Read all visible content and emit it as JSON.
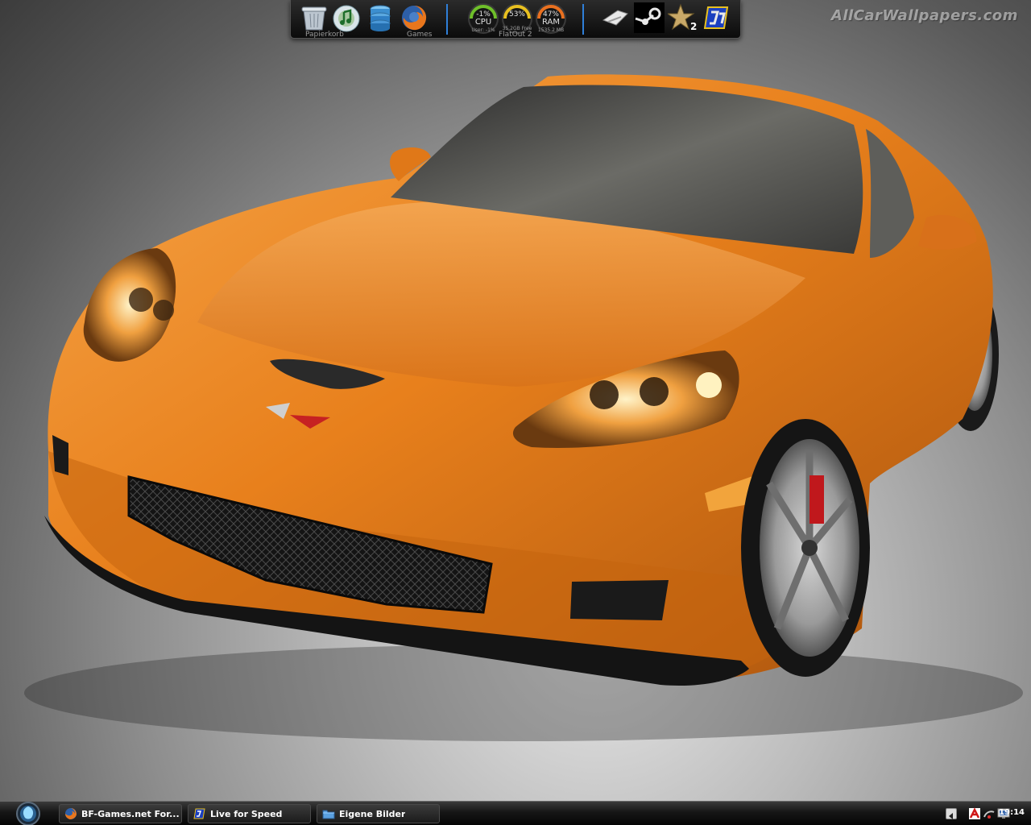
{
  "desktop": {
    "watermark": "AllCarWallpapers.com"
  },
  "dock": {
    "items": [
      {
        "name": "Papierkorb",
        "icon": "recycle-bin-icon"
      },
      {
        "name": "",
        "icon": "music-player-icon"
      },
      {
        "name": "",
        "icon": "database-icon"
      },
      {
        "name": "Games",
        "icon": "firefox-icon"
      }
    ],
    "gauges": [
      {
        "name": "CPU",
        "pct": "-1%",
        "sub": "User: -1%"
      },
      {
        "name": "C:\\",
        "pct": "53%",
        "sub": "35.2GB Free",
        "label": "FlatOut 2"
      },
      {
        "name": "RAM",
        "pct": "47%",
        "sub": "1535.2 MB"
      }
    ],
    "launchers": [
      {
        "icon": "unknown-game-icon"
      },
      {
        "icon": "steam-icon"
      },
      {
        "icon": "star-2-icon"
      },
      {
        "icon": "live-for-speed-icon"
      }
    ]
  },
  "taskbar": {
    "buttons": [
      {
        "label": "BF-Games.net For...",
        "icon": "firefox-icon"
      },
      {
        "label": "Live for Speed",
        "icon": "live-for-speed-icon"
      },
      {
        "label": "Eigene Bilder",
        "icon": "folder-icon"
      }
    ],
    "clock": "19:14"
  },
  "colors": {
    "car": "#e8801c",
    "taskbar": "#101010",
    "accent": "#2f7fd8"
  }
}
